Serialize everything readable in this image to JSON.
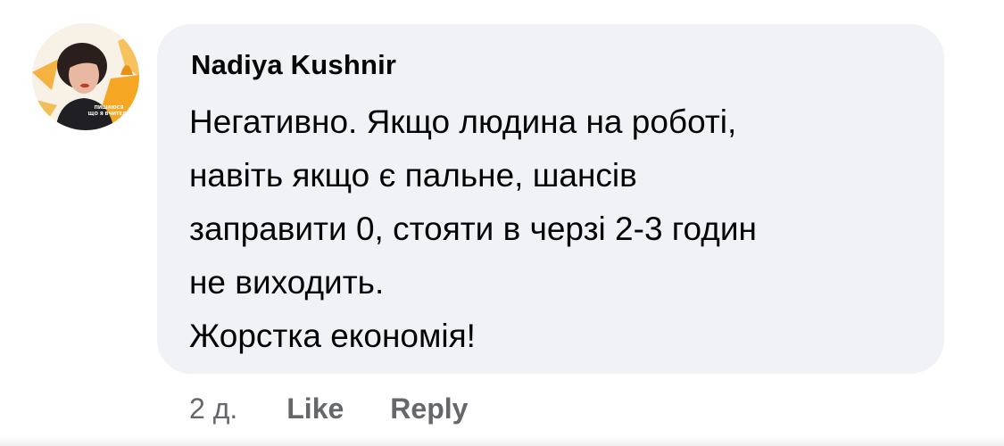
{
  "comment": {
    "author": "Nadiya Kushnir",
    "lines": [
      "Негативно. Якщо людина на роботі,",
      "навіть якщо є пальне, шансів",
      "заправити 0, стояти в черзі 2-3 годин",
      "не виходить.",
      "Жорстка економія!"
    ],
    "timestamp": "2 д.",
    "like_label": "Like",
    "reply_label": "Reply"
  },
  "avatar": {
    "badge_text": "пишаюся що я вчитель",
    "accent_color": "#f5a623"
  },
  "colors": {
    "bubble": "#f0f2f5",
    "text": "#050505",
    "secondary": "#65676b"
  }
}
